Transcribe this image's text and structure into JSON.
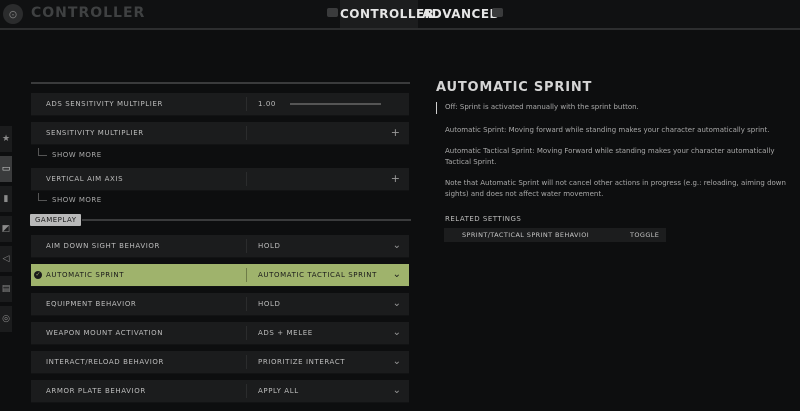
{
  "header": {
    "page_title": "CONTROLLER",
    "tabs": [
      {
        "label": "CONTROLLER",
        "active": true
      },
      {
        "label": "ADVANCED",
        "active": false
      }
    ]
  },
  "side_nav": {
    "icons": [
      "star-icon",
      "controller-icon",
      "weapon-icon",
      "interface-icon",
      "audio-icon",
      "account-icon",
      "network-icon"
    ]
  },
  "settings": {
    "ads_sensitivity": {
      "label": "ADS SENSITIVITY MULTIPLIER",
      "value": "1.00",
      "slider_level": 0.0
    },
    "sensitivity_multiplier": {
      "label": "SENSITIVITY MULTIPLIER"
    },
    "show_more_1": "SHOW MORE",
    "vertical_aim_axis": {
      "label": "VERTICAL AIM AXIS"
    },
    "show_more_2": "SHOW MORE",
    "section_gameplay": "GAMEPLAY",
    "rows": [
      {
        "label": "AIM DOWN SIGHT BEHAVIOR",
        "value": "HOLD"
      },
      {
        "label": "AUTOMATIC SPRINT",
        "value": "AUTOMATIC TACTICAL SPRINT",
        "selected": true
      },
      {
        "label": "EQUIPMENT BEHAVIOR",
        "value": "HOLD"
      },
      {
        "label": "WEAPON MOUNT ACTIVATION",
        "value": "ADS + MELEE"
      },
      {
        "label": "INTERACT/RELOAD BEHAVIOR",
        "value": "PRIORITIZE INTERACT"
      },
      {
        "label": "ARMOR PLATE BEHAVIOR",
        "value": "APPLY ALL"
      }
    ]
  },
  "detail": {
    "title": "AUTOMATIC SPRINT",
    "paragraphs": [
      "Off: Sprint is activated manually with the sprint button.",
      "Automatic Sprint: Moving forward while standing makes your character automatically sprint.",
      "Automatic Tactical Sprint: Moving Forward while standing makes your character automatically Tactical Sprint.",
      "Note that Automatic Sprint will not cancel other actions in progress (e.g.: reloading, aiming down sights) and does not affect water movement."
    ],
    "related_heading": "RELATED SETTINGS",
    "related": [
      {
        "label": "SPRINT/TACTICAL SPRINT BEHAVIOI",
        "value": "TOGGLE"
      }
    ]
  },
  "colors": {
    "selected_row": "#9fb36c",
    "background": "#0d0e0f",
    "row": "#1b1c1d"
  }
}
